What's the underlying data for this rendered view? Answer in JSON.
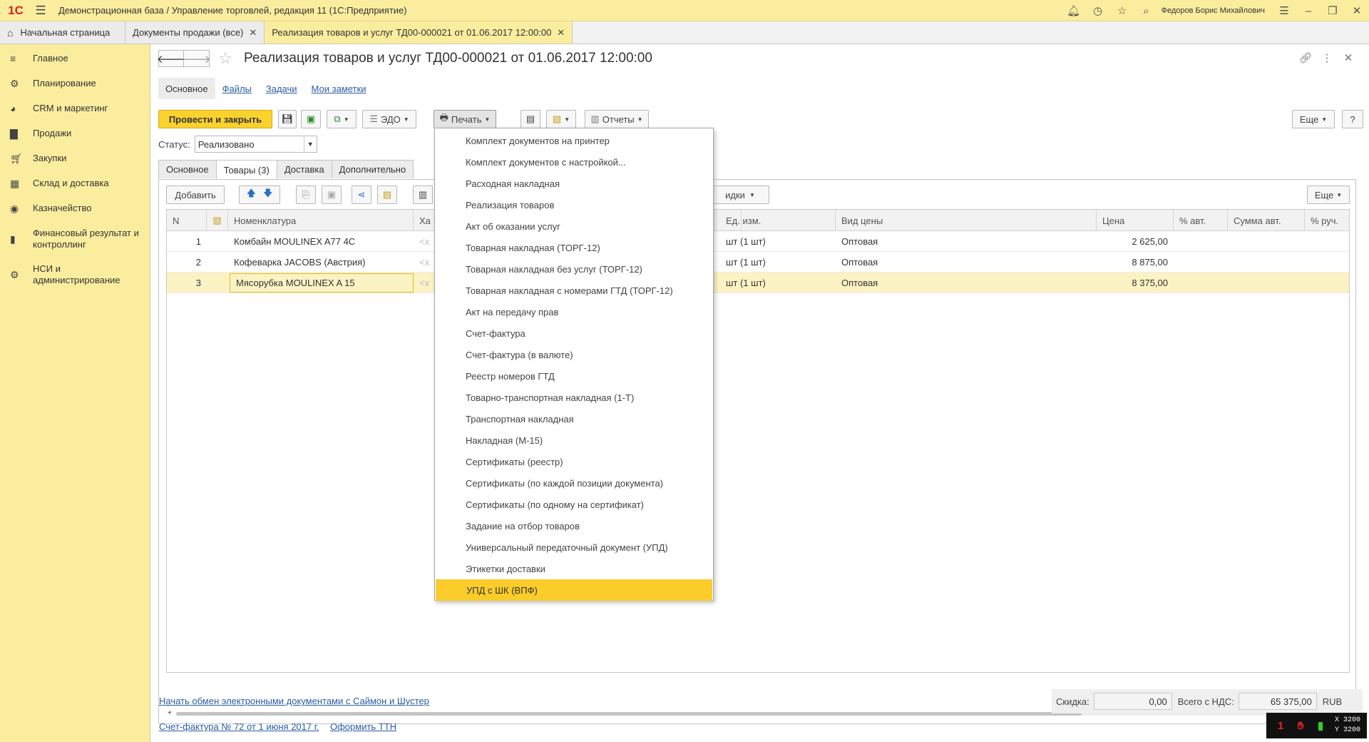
{
  "app": {
    "logo": "1С",
    "title": "Демонстрационная база / Управление торговлей, редакция 11  (1С:Предприятие)",
    "user": "Федоров Борис Михайлович"
  },
  "window_tabs": [
    {
      "label": "Начальная страница"
    },
    {
      "label": "Документы продажи (все)"
    },
    {
      "label": "Реализация товаров и услуг ТД00-000021 от 01.06.2017 12:00:00"
    }
  ],
  "sidebar": {
    "items": [
      {
        "icon": "list-icon",
        "label": "Главное"
      },
      {
        "icon": "planning-icon",
        "label": "Планирование"
      },
      {
        "icon": "crm-icon",
        "label": "CRM и маркетинг"
      },
      {
        "icon": "bag-icon",
        "label": "Продажи"
      },
      {
        "icon": "cart-icon",
        "label": "Закупки"
      },
      {
        "icon": "warehouse-icon",
        "label": "Склад и доставка"
      },
      {
        "icon": "treasury-icon",
        "label": "Казначейство"
      },
      {
        "icon": "chart-icon",
        "label": "Финансовый результат и контроллинг"
      },
      {
        "icon": "gear-icon",
        "label": "НСИ и администрирование"
      }
    ]
  },
  "document": {
    "title": "Реализация товаров и услуг ТД00-000021 от 01.06.2017 12:00:00",
    "subtabs": [
      "Основное",
      "Файлы",
      "Задачи",
      "Мои заметки"
    ],
    "toolbar": {
      "post_close": "Провести и закрыть",
      "edo": "ЭДО",
      "print": "Печать",
      "reports": "Отчеты",
      "more": "Еще",
      "help": "?"
    },
    "status_label": "Статус:",
    "status_value": "Реализовано",
    "panel_tabs": [
      "Основное",
      "Товары (3)",
      "Доставка",
      "Дополнительно"
    ],
    "panel_toolbar": {
      "add": "Добавить",
      "discounts": "идки",
      "more": "Еще"
    },
    "grid": {
      "columns": [
        "N",
        "",
        "Номенклатура",
        "Ха",
        "Ед. изм.",
        "Вид цены",
        "Цена",
        "% авт.",
        "Сумма авт.",
        "% руч."
      ],
      "rows": [
        {
          "n": "1",
          "item": "Комбайн MOULINEX  A77 4C",
          "char": "<х",
          "unit": "шт (1 шт)",
          "price_type": "Оптовая",
          "price": "2 625,00"
        },
        {
          "n": "2",
          "item": "Кофеварка JACOBS (Австрия)",
          "char": "<х",
          "unit": "шт (1 шт)",
          "price_type": "Оптовая",
          "price": "8 875,00"
        },
        {
          "n": "3",
          "item": "Мясорубка MOULINEX  A 15",
          "char": "<х",
          "unit": "шт (1 шт)",
          "price_type": "Оптовая",
          "price": "8 375,00"
        }
      ]
    }
  },
  "print_menu": {
    "items": [
      "Комплект документов на принтер",
      "Комплект документов с настройкой...",
      "Расходная накладная",
      "Реализация товаров",
      "Акт об оказании услуг",
      "Товарная накладная (ТОРГ-12)",
      "Товарная накладная без услуг (ТОРГ-12)",
      "Товарная накладная с номерами ГТД (ТОРГ-12)",
      "Акт на передачу прав",
      "Счет-фактура",
      "Счет-фактура (в валюте)",
      "Реестр номеров ГТД",
      "Товарно-транспортная накладная (1-Т)",
      "Транспортная накладная",
      "Накладная (М-15)",
      "Сертификаты (реестр)",
      "Сертификаты (по каждой позиции документа)",
      "Сертификаты (по одному на сертификат)",
      "Задание на отбор товаров",
      "Универсальный передаточный документ (УПД)",
      "Этикетки доставки",
      "УПД с ШК (ВПФ)"
    ],
    "highlighted_index": 21
  },
  "footer": {
    "edo_link": "Начать обмен электронными документами с Саймон и Шустер",
    "invoice_link": "Счет-фактура № 72 от 1 июня 2017 г.",
    "ttn_link": "Оформить ТТН",
    "discount_label": "Скидка:",
    "discount_value": "0,00",
    "total_label": "Всего с НДС:",
    "total_value": "65 375,00",
    "currency": "RUB"
  },
  "widget": {
    "x": "X 3200",
    "y": "Y 3200"
  },
  "colors": {
    "accent_yellow": "#fbed9e",
    "primary_button": "#fad22e",
    "menu_highlight": "#fbcc2a",
    "link": "#2a5ca8"
  }
}
